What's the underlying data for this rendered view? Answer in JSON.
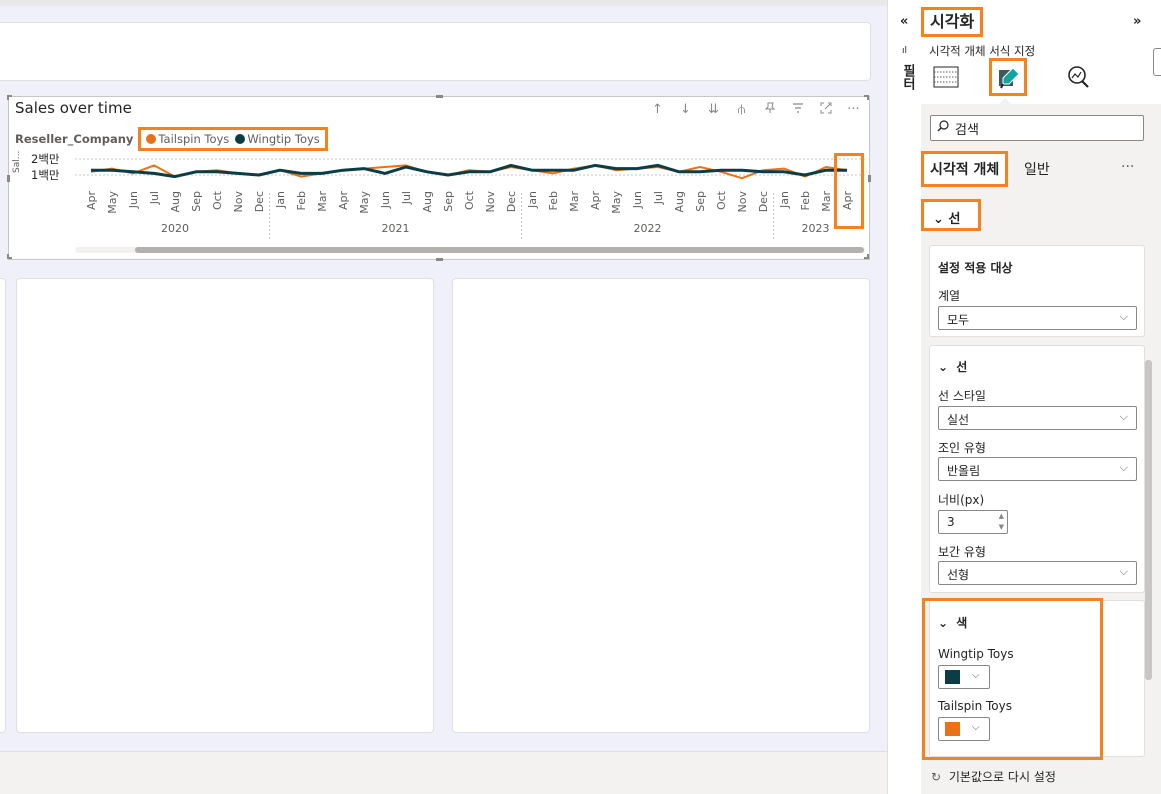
{
  "chart": {
    "title": "Sales over time",
    "legend_title": "Reseller_Company",
    "legend": [
      {
        "name": "Tailspin Toys",
        "color": "#e8711a"
      },
      {
        "name": "Wingtip Toys",
        "color": "#0b3d47"
      }
    ],
    "y_axis_abbrev": "Sal...",
    "y_ticks": [
      "2백만",
      "1백만"
    ],
    "tool_icons": [
      "arrow-up-icon",
      "arrow-down-icon",
      "double-arrow-down-icon",
      "expand-hierarchy-icon",
      "pin-icon",
      "filter-icon",
      "focus-mode-icon",
      "more-options-icon"
    ]
  },
  "chart_data": {
    "type": "line",
    "x": [
      "Apr",
      "May",
      "Jun",
      "Jul",
      "Aug",
      "Sep",
      "Oct",
      "Nov",
      "Dec",
      "Jan",
      "Feb",
      "Mar",
      "Apr",
      "May",
      "Jun",
      "Jul",
      "Aug",
      "Sep",
      "Oct",
      "Nov",
      "Dec",
      "Jan",
      "Feb",
      "Mar",
      "Apr",
      "May",
      "Jun",
      "Jul",
      "Aug",
      "Sep",
      "Oct",
      "Nov",
      "Dec",
      "Jan",
      "Feb",
      "Mar",
      "Apr"
    ],
    "years": [
      {
        "label": "2020",
        "start": 0,
        "end": 8
      },
      {
        "label": "2021",
        "start": 9,
        "end": 20
      },
      {
        "label": "2022",
        "start": 21,
        "end": 32
      },
      {
        "label": "2023",
        "start": 33,
        "end": 36
      }
    ],
    "series": [
      {
        "name": "Tailspin Toys",
        "color": "#e8711a",
        "values": [
          1.2,
          1.4,
          1.1,
          1.6,
          0.9,
          1.2,
          1.3,
          1.1,
          1.0,
          1.3,
          0.9,
          1.1,
          1.3,
          1.4,
          1.5,
          1.6,
          1.2,
          1.0,
          1.3,
          1.2,
          1.5,
          1.3,
          1.1,
          1.4,
          1.6,
          1.3,
          1.4,
          1.5,
          1.2,
          1.5,
          1.2,
          0.8,
          1.3,
          1.4,
          0.9,
          1.5,
          1.3
        ]
      },
      {
        "name": "Wingtip Toys",
        "color": "#0b3d47",
        "values": [
          1.3,
          1.3,
          1.2,
          1.1,
          0.9,
          1.2,
          1.2,
          1.1,
          1.0,
          1.3,
          1.1,
          1.1,
          1.3,
          1.4,
          1.1,
          1.5,
          1.2,
          1.0,
          1.2,
          1.2,
          1.6,
          1.3,
          1.3,
          1.3,
          1.6,
          1.4,
          1.4,
          1.6,
          1.2,
          1.2,
          1.3,
          1.3,
          1.2,
          1.2,
          1.0,
          1.3,
          1.3
        ]
      }
    ],
    "y_ticks": [
      "2백만",
      "1백만"
    ],
    "ylim": [
      0.5,
      2.1
    ]
  },
  "pane": {
    "title": "시각화",
    "collapse_glyph": "«",
    "expand_glyph": "»",
    "filters_label": "필터",
    "subtitle": "시각적 개체 서식 지정",
    "search_placeholder": "검색",
    "tab_visual": "시각적 개체",
    "tab_general": "일반",
    "tab_more": "···",
    "section_line": "선",
    "apply_to_label": "설정 적용 대상",
    "series_label": "계열",
    "series_value": "모두",
    "line_group_label": "선",
    "line_style_label": "선 스타일",
    "line_style_value": "실선",
    "join_type_label": "조인 유형",
    "join_type_value": "반올림",
    "width_label": "너비(px)",
    "width_value": "3",
    "interp_label": "보간 유형",
    "interp_value": "선형",
    "color_group_label": "색",
    "color_wingtip_label": "Wingtip Toys",
    "color_wingtip": "#0b3d47",
    "color_tailspin_label": "Tailspin Toys",
    "color_tailspin": "#e8711a",
    "reset_label": "기본값으로 다시 설정"
  }
}
